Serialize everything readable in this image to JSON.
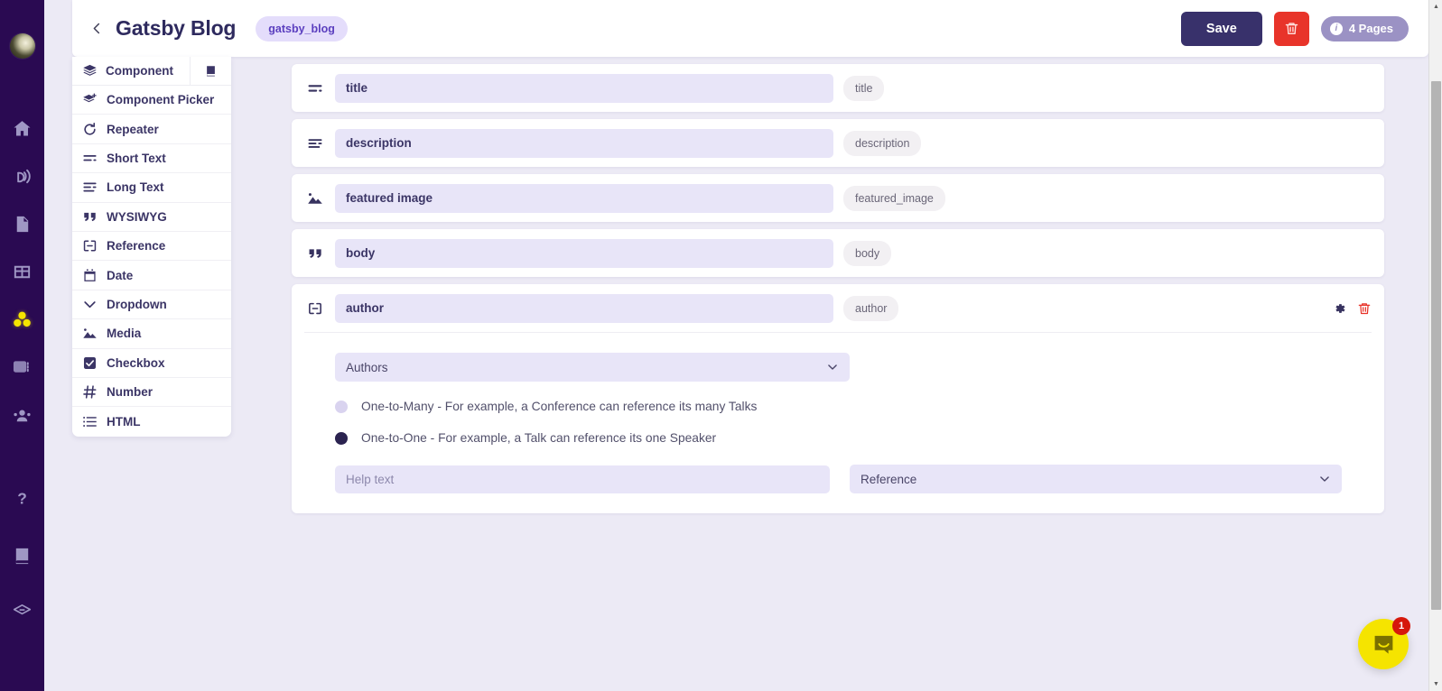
{
  "rail": {
    "logo_name": "workspace-avatar",
    "items": [
      {
        "icon": "home-icon",
        "name": "home"
      },
      {
        "icon": "broadcast-icon",
        "name": "broadcast"
      },
      {
        "icon": "document-icon",
        "name": "documents"
      },
      {
        "icon": "table-icon",
        "name": "tables"
      },
      {
        "icon": "components-icon",
        "name": "components",
        "active": true
      },
      {
        "icon": "media-icon",
        "name": "media"
      },
      {
        "icon": "users-icon",
        "name": "users"
      },
      {
        "icon": "help-icon",
        "name": "help"
      },
      {
        "icon": "book-icon",
        "name": "docs"
      },
      {
        "icon": "layers-icon",
        "name": "layers"
      }
    ]
  },
  "header": {
    "back_label": "Back",
    "title": "Gatsby Blog",
    "slug": "gatsby_blog",
    "save_label": "Save",
    "delete_label": "Delete",
    "pages_badge": "4 Pages"
  },
  "type_panel": {
    "header": {
      "label": "Component",
      "icon": "stack-icon",
      "book_icon": "book-icon"
    },
    "items": [
      {
        "label": "Component Picker",
        "icon": "stack-plus-icon"
      },
      {
        "label": "Repeater",
        "icon": "repeat-icon"
      },
      {
        "label": "Short Text",
        "icon": "short-text-icon"
      },
      {
        "label": "Long Text",
        "icon": "long-text-icon"
      },
      {
        "label": "WYSIWYG",
        "icon": "quote-icon"
      },
      {
        "label": "Reference",
        "icon": "link-icon"
      },
      {
        "label": "Date",
        "icon": "calendar-icon"
      },
      {
        "label": "Dropdown",
        "icon": "chevron-down-icon"
      },
      {
        "label": "Media",
        "icon": "image-icon"
      },
      {
        "label": "Checkbox",
        "icon": "checkbox-icon"
      },
      {
        "label": "Number",
        "icon": "hash-icon"
      },
      {
        "label": "HTML",
        "icon": "list-icon"
      }
    ]
  },
  "fields": [
    {
      "name": "title",
      "key": "title",
      "icon": "short-text-icon"
    },
    {
      "name": "description",
      "key": "description",
      "icon": "long-text-icon"
    },
    {
      "name": "featured image",
      "key": "featured_image",
      "icon": "image-icon"
    },
    {
      "name": "body",
      "key": "body",
      "icon": "quote-icon"
    }
  ],
  "author_field": {
    "name": "author",
    "key": "author",
    "icon": "link-icon",
    "settings_icon": "gear-icon",
    "delete_icon": "trash-icon",
    "collection_select": "Authors",
    "relation_options": [
      {
        "label": "One-to-Many - For example, a Conference can reference its many Talks",
        "checked": false
      },
      {
        "label": "One-to-One - For example, a Talk can reference its one Speaker",
        "checked": true
      }
    ],
    "help_placeholder": "Help text",
    "help_value": "",
    "type_select": "Reference"
  },
  "chat": {
    "badge": "1",
    "icon": "chat-icon"
  },
  "colors": {
    "rail_bg": "#2a0a52",
    "page_bg": "#eceaf5",
    "accent_purple": "#38316b",
    "input_bg": "#e8e5f8",
    "danger_red": "#e8342a",
    "chat_yellow": "#f5e400",
    "active_yellow": "#f5e400",
    "badge_purple": "#9b92c4",
    "slug_chip_bg": "#e4ddfb"
  }
}
